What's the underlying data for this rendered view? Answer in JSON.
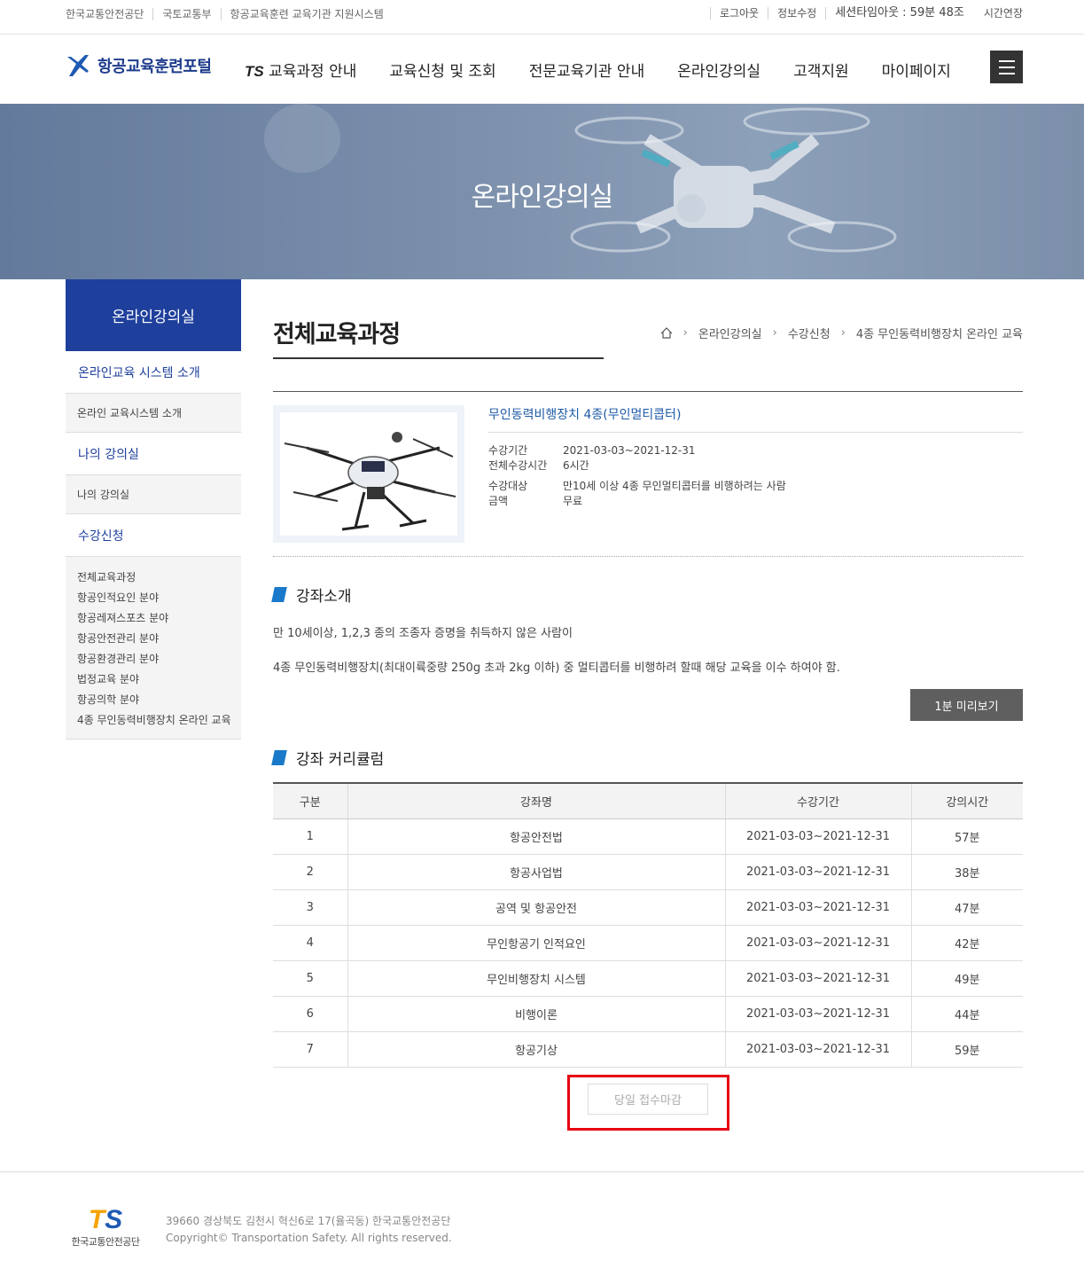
{
  "util": {
    "left": [
      "한국교통안전공단",
      "국토교통부",
      "항공교육훈련 교육기관 지원시스템"
    ],
    "logout": "로그아웃",
    "edit_info": "정보수정",
    "session": "세션타임아웃 : 59분 48조",
    "extend": "시간연장"
  },
  "header": {
    "logo_text": "항공교육훈련포털",
    "nav": [
      "TS",
      "교육과정 안내",
      "교육신청 및 조회",
      "전문교육기관 안내",
      "온라인강의실",
      "고객지원",
      "마이페이지"
    ]
  },
  "banner": {
    "title": "온라인강의실"
  },
  "sidebar": {
    "title": "온라인강의실",
    "sec1": "온라인교육 시스템 소개",
    "sub1": "온라인 교육시스템 소개",
    "sec2": "나의 강의실",
    "sub2": "나의 강의실",
    "sec3": "수강신청",
    "items": [
      "전체교육과정",
      "항공인적요인 분야",
      "항공레져스포츠 분야",
      "항공안전관리 분야",
      "항공환경관리 분야",
      "법정교육 분야",
      "항공의학 분야",
      "4종 무인동력비행장치 온라인 교육"
    ]
  },
  "content": {
    "title": "전체교육과정",
    "breadcrumb": [
      "온라인강의실",
      "수강신청",
      "4종 무인동력비행장치 온라인 교육"
    ],
    "course": {
      "name": "무인동력비행장치 4종(무인멀티콥터)",
      "period_label": "수강기간",
      "period": "2021-03-03~2021-12-31",
      "total_label": "전체수강시간",
      "total": "6시간",
      "target_label": "수강대상",
      "target": "만10세 이상 4종 무인멀티콥터를 비행하려는 사람",
      "price_label": "금액",
      "price": "무료"
    },
    "intro_title": "강좌소개",
    "intro_1": "만 10세이상, 1,2,3 종의 조종자 증명을 취득하지 않은 사람이",
    "intro_2": "4종 무인동력비행장치(최대이륙중량 250g 초과 2kg 이하) 중 멀티콥터를 비행하려 할때 해당 교육을 이수 하여야 함.",
    "preview_btn": "1분 미리보기",
    "curriculum_title": "강좌 커리큘럼",
    "table": {
      "headers": [
        "구분",
        "강좌명",
        "수강기간",
        "강의시간"
      ],
      "rows": [
        [
          "1",
          "항공안전법",
          "2021-03-03~2021-12-31",
          "57분"
        ],
        [
          "2",
          "항공사업법",
          "2021-03-03~2021-12-31",
          "38분"
        ],
        [
          "3",
          "공역 및 항공안전",
          "2021-03-03~2021-12-31",
          "47분"
        ],
        [
          "4",
          "무인항공기 인적요인",
          "2021-03-03~2021-12-31",
          "42분"
        ],
        [
          "5",
          "무인비행장치 시스템",
          "2021-03-03~2021-12-31",
          "49분"
        ],
        [
          "6",
          "비행이론",
          "2021-03-03~2021-12-31",
          "44분"
        ],
        [
          "7",
          "항공기상",
          "2021-03-03~2021-12-31",
          "59분"
        ]
      ]
    },
    "closed_btn": "당일 접수마감"
  },
  "footer": {
    "logo_ts": "TS",
    "logo_name": "한국교통안전공단",
    "address": "39660 경상북도 김천시 혁신6로 17(율곡동) 한국교통안전공단",
    "copyright": "Copyright© Transportation Safety. All rights reserved."
  },
  "colors": {
    "brand": "#1e3f9c",
    "accent": "#1a7ac9",
    "highlight": "#e60012"
  }
}
